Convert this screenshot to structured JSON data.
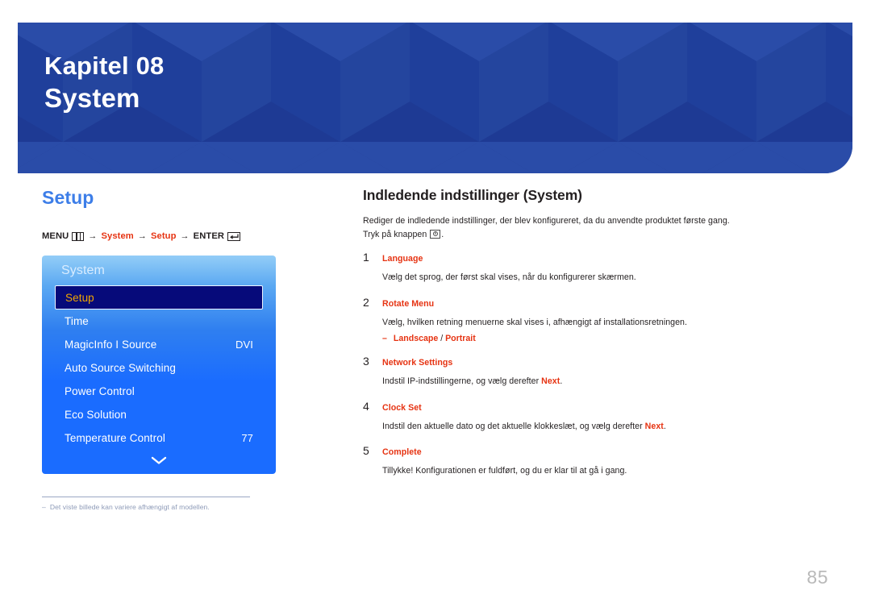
{
  "banner": {
    "chapter_label": "Kapitel 08",
    "chapter_title": "System",
    "background_color": "#1e3a94"
  },
  "left": {
    "section_title": "Setup",
    "breadcrumb": {
      "menu_label": "MENU",
      "menu_icon": "menu-icon",
      "arrow": "→",
      "path_1": "System",
      "path_2": "Setup",
      "enter_label": "ENTER",
      "enter_icon": "enter-icon",
      "accent_color": "#e63312"
    },
    "osd": {
      "title": "System",
      "scroll_icon": "chevron-down-icon",
      "selected_index": 0,
      "highlight_bg": "#060a7a",
      "highlight_text_color": "#f0a500",
      "rows": [
        {
          "label": "Setup",
          "value": ""
        },
        {
          "label": "Time",
          "value": ""
        },
        {
          "label": "MagicInfo I Source",
          "value": "DVI"
        },
        {
          "label": "Auto Source Switching",
          "value": ""
        },
        {
          "label": "Power Control",
          "value": ""
        },
        {
          "label": "Eco Solution",
          "value": ""
        },
        {
          "label": "Temperature Control",
          "value": "77"
        }
      ]
    },
    "footnote": {
      "dash": "–",
      "text": "Det viste billede kan variere afhængigt af modellen."
    }
  },
  "right": {
    "title": "Indledende indstillinger (System)",
    "intro_line_1": "Rediger de indledende indstillinger, der blev konfigureret, da du anvendte produktet første gang.",
    "intro_line_2_before": "Tryk på knappen",
    "intro_line_2_after": ".",
    "power_icon": "power-button-icon",
    "steps": [
      {
        "num": "1",
        "label": "Language",
        "body": "Vælg det sprog, der først skal vises, når du konfigurerer skærmen."
      },
      {
        "num": "2",
        "label": "Rotate Menu",
        "body": "Vælg, hvilken retning menuerne skal vises i, afhængigt af installationsretningen.",
        "sub_dash": "–",
        "sub_a": "Landscape",
        "sub_sep": " / ",
        "sub_b": "Portrait"
      },
      {
        "num": "3",
        "label": "Network Settings",
        "body_before": "Indstil IP-indstillingerne, og vælg derefter ",
        "body_hl": "Next",
        "body_after": "."
      },
      {
        "num": "4",
        "label": "Clock Set",
        "body_before": "Indstil den aktuelle dato og det aktuelle klokkeslæt, og vælg derefter ",
        "body_hl": "Next",
        "body_after": "."
      },
      {
        "num": "5",
        "label": "Complete",
        "body": "Tillykke! Konfigurationen er fuldført, og du er klar til at gå i gang."
      }
    ]
  },
  "page_number": "85"
}
